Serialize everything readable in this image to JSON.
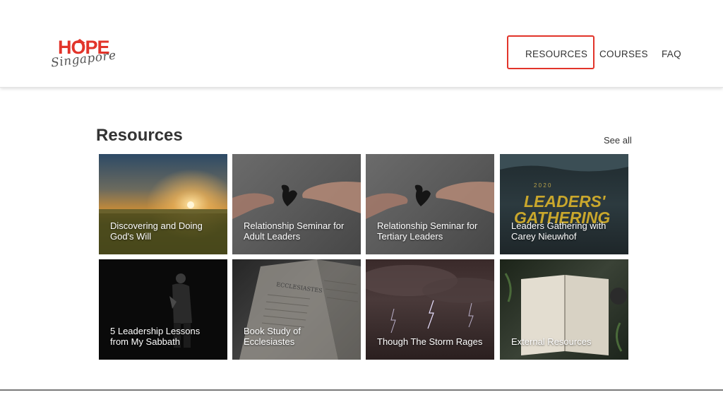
{
  "logo": {
    "word": "HOPE",
    "sub": "Singapore"
  },
  "nav": {
    "resources": "RESOURCES",
    "courses": "COURSES",
    "faq": "FAQ"
  },
  "section": {
    "title": "Resources",
    "see_all": "See all"
  },
  "cards": [
    {
      "label": "Discovering and Doing God's Will",
      "image": "sunset-field"
    },
    {
      "label": "Relationship Seminar for Adult Leaders",
      "image": "hands-heart"
    },
    {
      "label": "Relationship Seminar for Tertiary Leaders",
      "image": "hands-heart"
    },
    {
      "label": "Leaders Gathering with Carey Nieuwhof",
      "image": "leaders-gathering-poster",
      "poster_year": "2 0 2 0",
      "poster_line1": "LEADERS'",
      "poster_line2": "GATHERING"
    },
    {
      "label": "5 Leadership Lessons from My Sabbath",
      "image": "man-praying-dark"
    },
    {
      "label": "Book Study of Ecclesiastes",
      "image": "open-bible-ecclesiastes",
      "book_word": "ECCLESIASTES"
    },
    {
      "label": "Though The Storm Rages",
      "image": "lightning-storm"
    },
    {
      "label": "External Resources",
      "image": "bible-on-table"
    }
  ],
  "colors": {
    "brand": "#e2342a",
    "text": "#333333"
  }
}
